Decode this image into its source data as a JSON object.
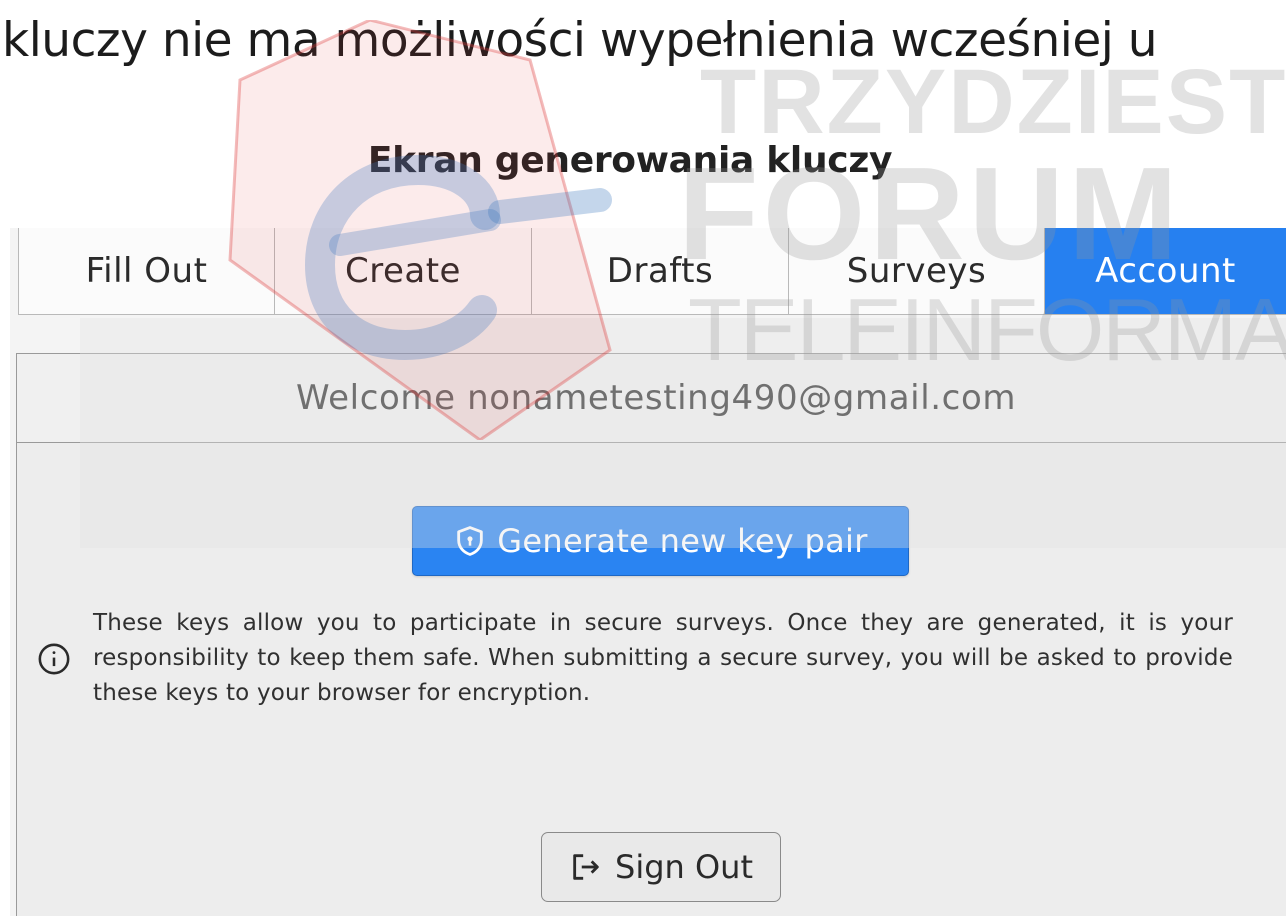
{
  "doc": {
    "top_text": "kluczy nie ma możliwości wypełnienia wcześniej u",
    "figure_title": "Ekran generowania kluczy"
  },
  "watermark": {
    "line1": "TRZYDZIESTE",
    "line2": "FORUM",
    "line3": "TELEINFORMATYKI®"
  },
  "tabs": [
    {
      "label": "Fill Out",
      "active": false
    },
    {
      "label": "Create",
      "active": false
    },
    {
      "label": "Drafts",
      "active": false
    },
    {
      "label": "Surveys",
      "active": false
    },
    {
      "label": "Account",
      "active": true
    }
  ],
  "account": {
    "welcome": "Welcome nonametesting490@gmail.com",
    "generate_label": "Generate new key pair",
    "info": "These keys allow you to participate in secure surveys. Once they are generated, it is your responsibility to keep them safe. When submitting a secure survey, you will be asked to provide these keys to your browser for encryption.",
    "signout_label": "Sign Out"
  },
  "colors": {
    "accent": "#2680f0",
    "card_bg": "#ededed"
  },
  "icons": {
    "generate": "shield-lock-icon",
    "info": "info-circle-icon",
    "signout": "sign-out-icon"
  }
}
